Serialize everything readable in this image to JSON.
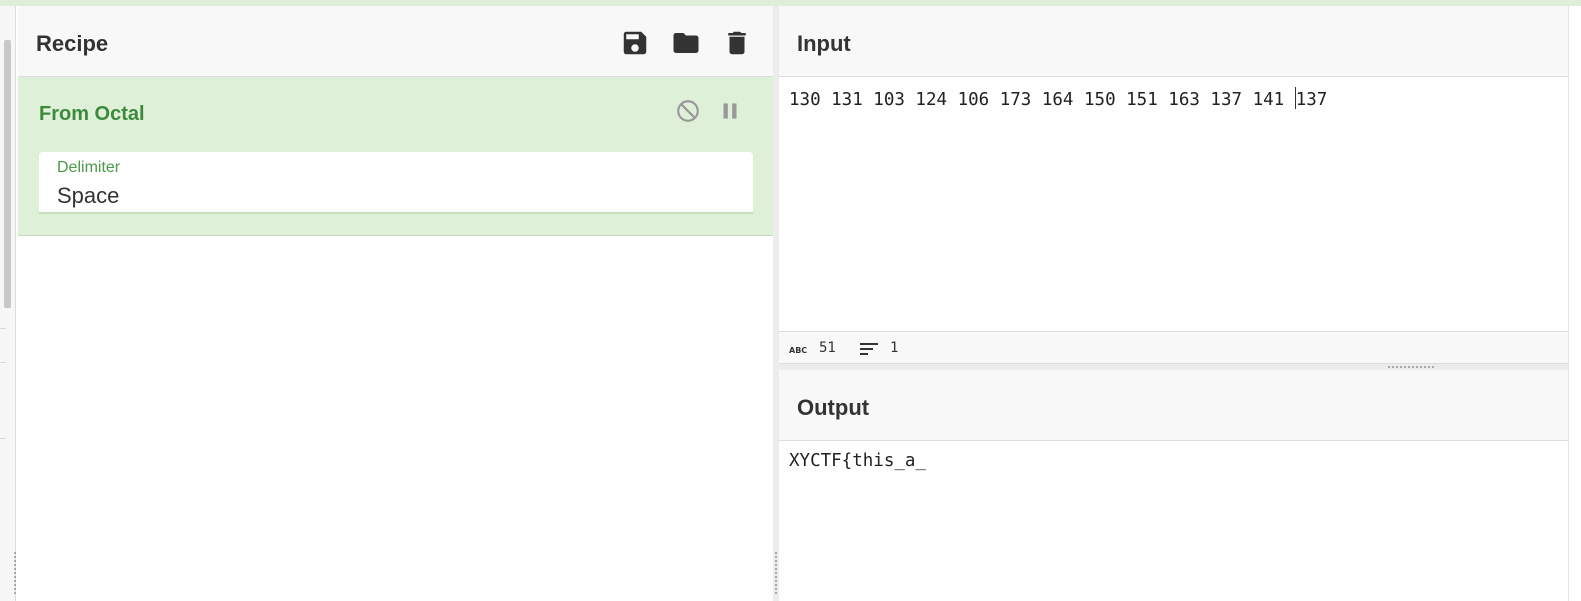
{
  "recipe": {
    "title": "Recipe",
    "icons": [
      "save-icon",
      "folder-icon",
      "trash-icon"
    ],
    "operation": {
      "name": "From Octal",
      "controls": [
        "disable-icon",
        "pause-icon"
      ],
      "argument_label": "Delimiter",
      "argument_value": "Space"
    }
  },
  "input": {
    "title": "Input",
    "text_before_caret": "130 131 103 124 106 173 164 150 151 163 137 141 ",
    "text_after_caret": "137",
    "length_icon": "abc-icon",
    "length": "51",
    "lines_icon": "lines-icon",
    "lines": "1"
  },
  "output": {
    "title": "Output",
    "text": "XYCTF{this_a_"
  },
  "colors": {
    "accent_green": "#3c8a3c",
    "card_green": "#dff0d8",
    "icon_dark": "#333333",
    "icon_muted": "#999999"
  }
}
